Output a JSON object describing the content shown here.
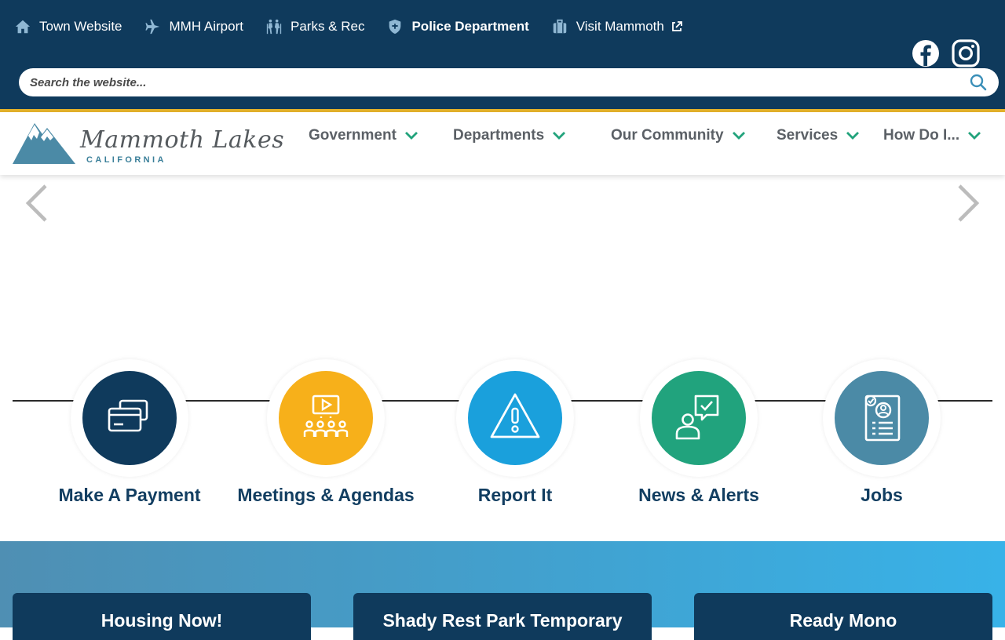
{
  "utility_nav": {
    "links": [
      {
        "label": "Town Website",
        "icon": "house-icon"
      },
      {
        "label": "MMH Airport",
        "icon": "airplane-icon"
      },
      {
        "label": "Parks & Rec",
        "icon": "hikers-icon"
      },
      {
        "label": "Police Department",
        "icon": "police-shield-icon"
      },
      {
        "label": "Visit Mammoth",
        "icon": "suitcase-icon",
        "external": true
      }
    ],
    "social": [
      {
        "name": "facebook-icon"
      },
      {
        "name": "instagram-icon"
      }
    ]
  },
  "search": {
    "placeholder": "Search the website...",
    "value": ""
  },
  "logo": {
    "script": "Mammoth Lakes",
    "sub": "CALIFORNIA"
  },
  "main_nav": {
    "items": [
      {
        "label": "Government"
      },
      {
        "label": "Departments"
      },
      {
        "label": "Our Community"
      },
      {
        "label": "Services"
      },
      {
        "label": "How Do I..."
      }
    ]
  },
  "quick_links": [
    {
      "label": "Make A Payment",
      "icon": "payment-cards-icon",
      "color": "#0f3a5c"
    },
    {
      "label": "Meetings & Agendas",
      "icon": "meeting-video-icon",
      "color": "#f7b01a"
    },
    {
      "label": "Report It",
      "icon": "warning-triangle-icon",
      "color": "#1aa0dc"
    },
    {
      "label": "News & Alerts",
      "icon": "person-chat-check-icon",
      "color": "#21a37d"
    },
    {
      "label": "Jobs",
      "icon": "resume-document-icon",
      "color": "#4b8aa6"
    }
  ],
  "cards": [
    {
      "title": "Housing Now!"
    },
    {
      "title": "Shady Rest Park Temporary"
    },
    {
      "title": "Ready Mono"
    }
  ],
  "colors": {
    "navy": "#0f3a5c",
    "gold": "#e3b12a",
    "chevron_green": "#22a37c",
    "nav_text": "#5b6066"
  }
}
